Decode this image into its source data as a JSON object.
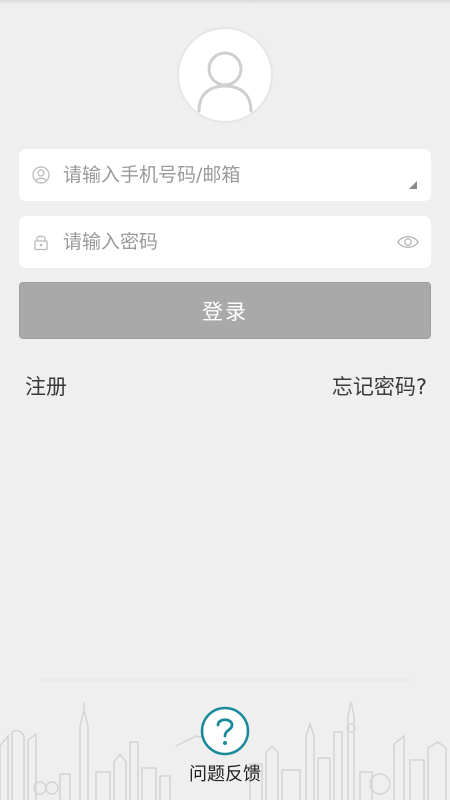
{
  "login_form": {
    "account_placeholder": "请输入手机号码/邮箱",
    "password_placeholder": "请输入密码",
    "login_label": "登录"
  },
  "links": {
    "register": "注册",
    "forgot_password": "忘记密码?"
  },
  "footer": {
    "feedback_label": "问题反馈"
  },
  "icons": {
    "avatar": "user-silhouette",
    "account_field": "user-outline",
    "password_field": "lock-outline",
    "password_toggle": "eye-outline",
    "feedback": "question-circle"
  },
  "colors": {
    "background": "#efefef",
    "button_disabled": "#a9a9a9",
    "accent": "#1a8a9a"
  }
}
